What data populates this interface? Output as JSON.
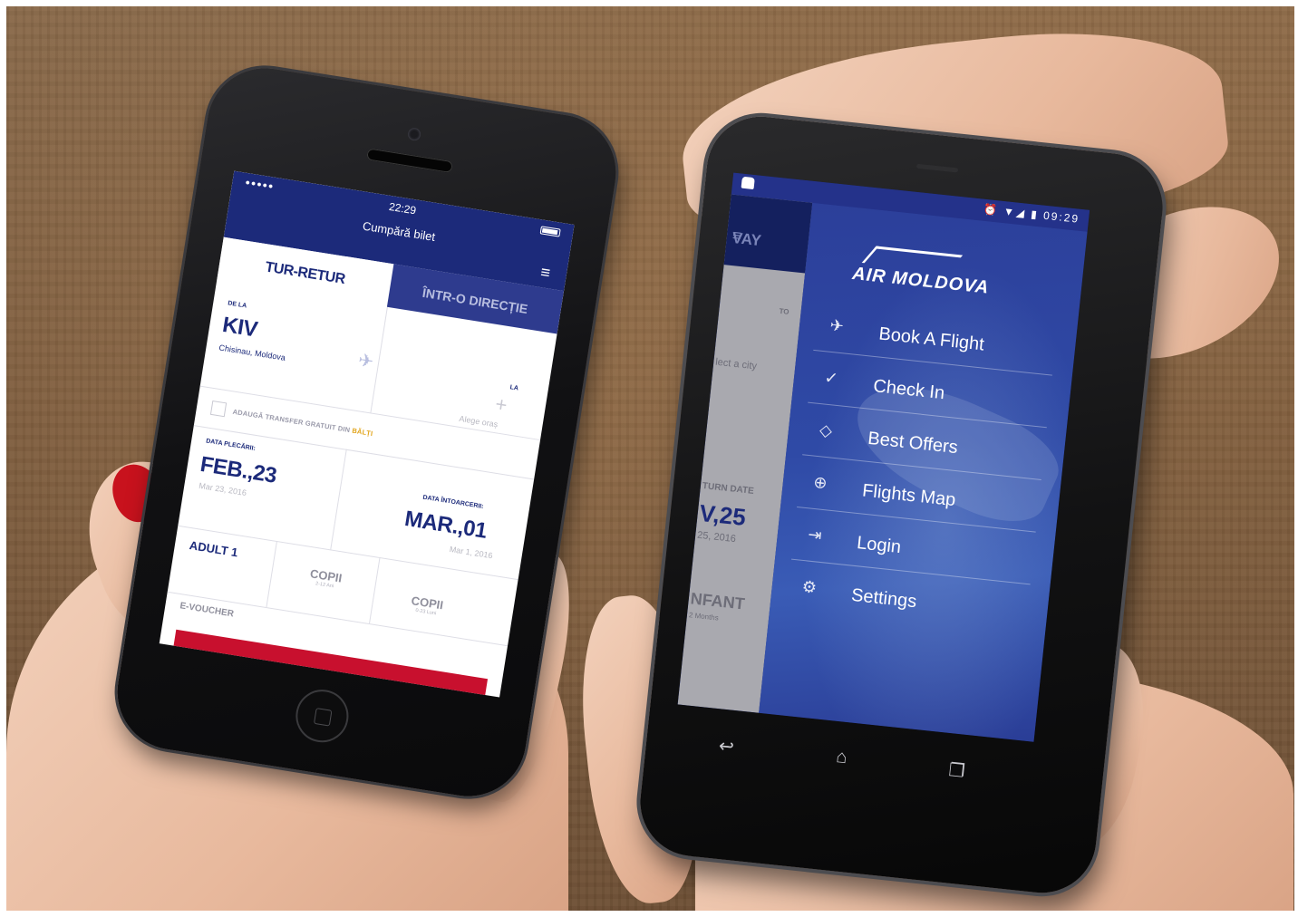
{
  "iphone": {
    "status": {
      "signal": "●●●●●",
      "time": "22:29"
    },
    "header_title": "Cumpără bilet",
    "tabs": {
      "active": "TUR-RETUR",
      "other": "ÎNTR-O DIRECȚIE"
    },
    "from": {
      "label": "DE LA",
      "code": "KIV",
      "city": "Chisinau, Moldova"
    },
    "to": {
      "label": "LA",
      "placeholder": "Alege oraș"
    },
    "transfer": {
      "text": "ADAUGĂ TRANSFER GRATUIT DIN",
      "highlight": "BĂLȚI"
    },
    "departure": {
      "label": "DATA PLECĂRII:",
      "value": "FEB.,23",
      "sub": "Mar 23, 2016"
    },
    "return": {
      "label": "DATA ÎNTOARCERII:",
      "value": "MAR.,01",
      "sub": "Mar 1, 2016"
    },
    "passengers": {
      "adult": "ADULT 1",
      "child1": "COPII",
      "child1_sub": "2-12 Ani",
      "child2": "COPII",
      "child2_sub": "0-23 Luni"
    },
    "voucher": "E-VOUCHER",
    "colors": {
      "primary": "#1c2a7a",
      "accent": "#c8102e",
      "highlight": "#e2a51c"
    }
  },
  "android": {
    "status": {
      "time": "09:29"
    },
    "logo_text": "AIR MOLDOVA",
    "underlay": {
      "tab": "VAY",
      "to_label": "TO",
      "to_placeholder": "lect a city",
      "return_label": "TURN DATE",
      "return_value": "V,25",
      "return_sub": "25, 2016",
      "pax": "NFANT",
      "pax_sub": "2 Months"
    },
    "menu": [
      {
        "label": "Book A Flight",
        "icon": "plane-icon"
      },
      {
        "label": "Check In",
        "icon": "check-circle-icon"
      },
      {
        "label": "Best Offers",
        "icon": "tag-icon"
      },
      {
        "label": "Flights Map",
        "icon": "globe-icon"
      },
      {
        "label": "Login",
        "icon": "login-icon"
      },
      {
        "label": "Settings",
        "icon": "gear-icon"
      }
    ],
    "colors": {
      "drawer": "#2f4aa6",
      "statusbar": "#24328a"
    }
  }
}
